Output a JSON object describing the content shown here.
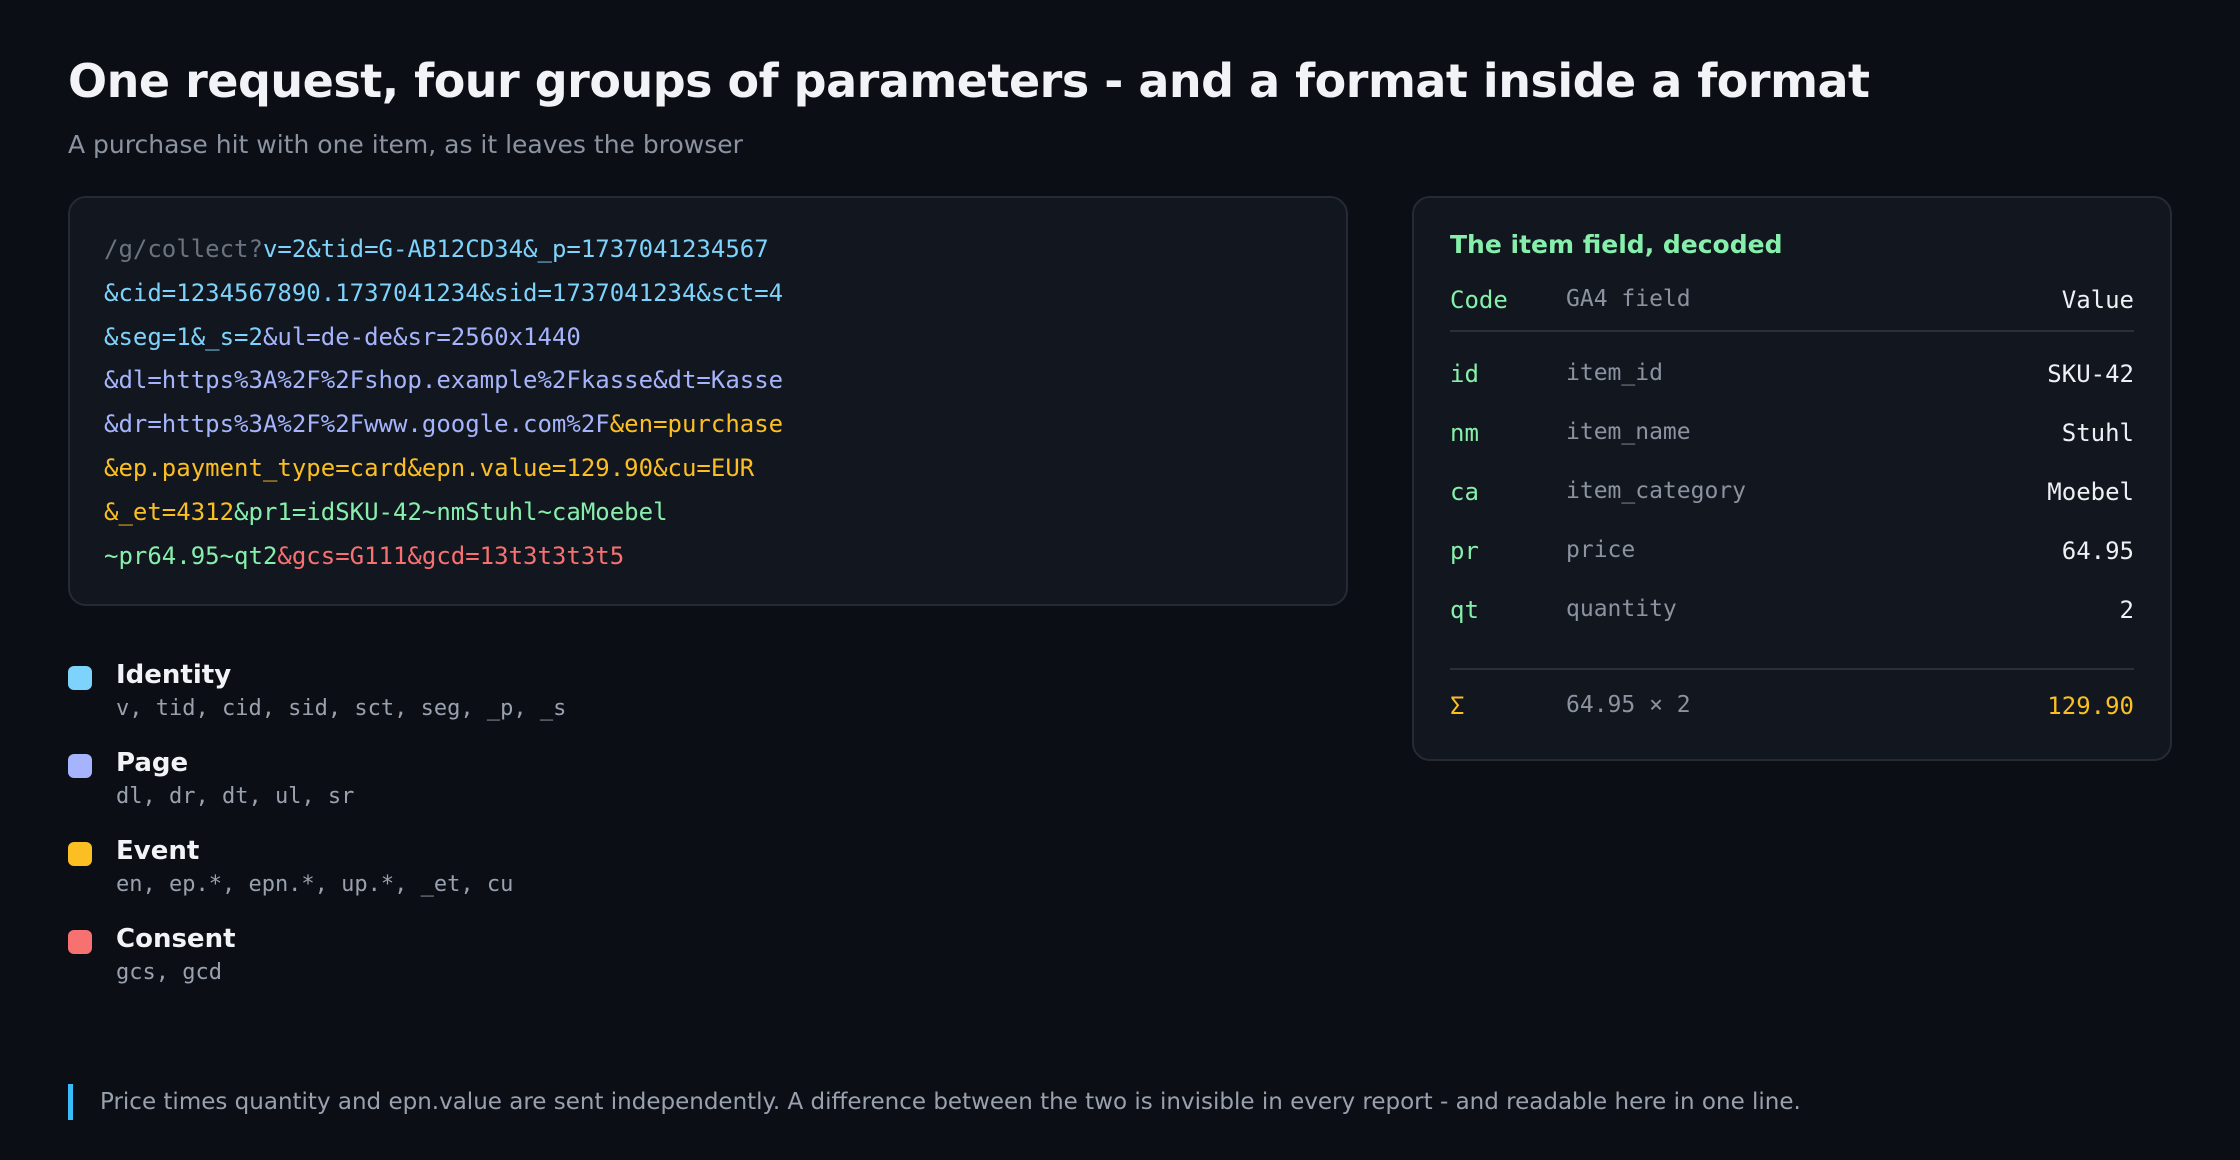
{
  "header": {
    "title": "One request, four groups of parameters - and a format inside a format",
    "subtitle": "A purchase hit with one item, as it leaves the browser"
  },
  "request": {
    "lines": [
      [
        {
          "text": "/g/collect?",
          "group": "path"
        },
        {
          "text": "v=2&tid=G-AB12CD34&_p=1737041234567",
          "group": "identity"
        }
      ],
      [
        {
          "text": "&cid=1234567890.1737041234&sid=1737041234&sct=4",
          "group": "identity"
        }
      ],
      [
        {
          "text": "&seg=1&_s=2",
          "group": "identity"
        },
        {
          "text": "&ul=de-de&sr=2560x1440",
          "group": "page"
        }
      ],
      [
        {
          "text": "&dl=https%3A%2F%2Fshop.example%2Fkasse&dt=Kasse",
          "group": "page"
        }
      ],
      [
        {
          "text": "&dr=https%3A%2F%2Fwww.google.com%2F",
          "group": "page"
        },
        {
          "text": "&en=purchase",
          "group": "event"
        }
      ],
      [
        {
          "text": "&ep.payment_type=card&epn.value=129.90&cu=EUR",
          "group": "event"
        }
      ],
      [
        {
          "text": "&_et=4312",
          "group": "event"
        },
        {
          "text": "&pr1=idSKU-42~nmStuhl~caMoebel",
          "group": "item"
        }
      ],
      [
        {
          "text": "~pr64.95~qt2",
          "group": "item"
        },
        {
          "text": "&gcs=G111&gcd=13t3t3t3t5",
          "group": "consent"
        }
      ]
    ]
  },
  "colors": {
    "path": "#6b7280",
    "identity": "#7dd3fc",
    "page": "#a5b4fc",
    "event": "#fbbf24",
    "item": "#86efac",
    "consent": "#f87171"
  },
  "legend": [
    {
      "label": "Identity",
      "params": "v, tid, cid, sid, sct, seg, _p, _s",
      "color": "#7dd3fc"
    },
    {
      "label": "Page",
      "params": "dl, dr, dt, ul, sr",
      "color": "#a5b4fc"
    },
    {
      "label": "Event",
      "params": "en, ep.*, epn.*, up.*, _et, cu",
      "color": "#fbbf24"
    },
    {
      "label": "Consent",
      "params": "gcs, gcd",
      "color": "#f87171"
    }
  ],
  "decoded": {
    "title": "The item field, decoded",
    "columns": {
      "code": "Code",
      "field": "GA4 field",
      "value": "Value"
    },
    "rows": [
      {
        "code": "id",
        "field": "item_id",
        "value": "SKU-42"
      },
      {
        "code": "nm",
        "field": "item_name",
        "value": "Stuhl"
      },
      {
        "code": "ca",
        "field": "item_category",
        "value": "Moebel"
      },
      {
        "code": "pr",
        "field": "price",
        "value": "64.95"
      },
      {
        "code": "qt",
        "field": "quantity",
        "value": "2"
      }
    ],
    "sum": {
      "symbol": "Σ",
      "formula": "64.95 × 2",
      "value": "129.90"
    }
  },
  "note": "Price times quantity and epn.value are sent independently. A difference between the two is invisible in every report - and readable here in one line."
}
